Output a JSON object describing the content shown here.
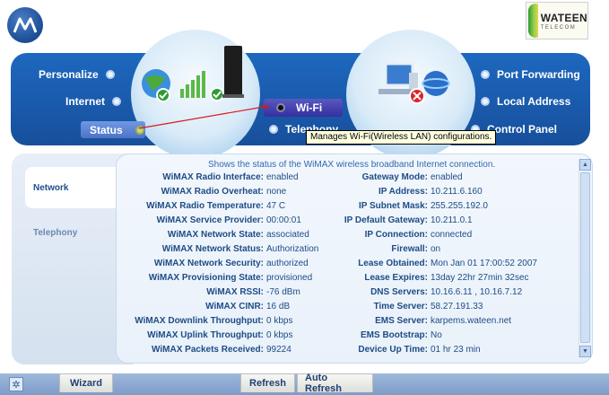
{
  "header": {
    "brand_logo": "motorola-logo",
    "partner_logo": {
      "name": "WATEEN",
      "tagline": "TELECOM"
    }
  },
  "nav": {
    "left_items": [
      {
        "label": "Personalize",
        "selected": false
      },
      {
        "label": "Internet",
        "selected": false
      },
      {
        "label": "Status",
        "selected": true
      }
    ],
    "center_items": [
      {
        "label": "Wi-Fi",
        "selected": true
      },
      {
        "label": "Telephony",
        "selected": false
      }
    ],
    "right_items": [
      {
        "label": "Port Forwarding",
        "selected": false
      },
      {
        "label": "Local Address",
        "selected": false
      },
      {
        "label": "Control Panel",
        "selected": false
      }
    ],
    "tooltip": "Manages Wi-Fi(Wireless LAN) configurations."
  },
  "side_tabs": {
    "network": "Network",
    "telephony": "Telephony"
  },
  "panel": {
    "title": "Shows the status of the WiMAX wireless broadband Internet connection.",
    "left_rows": [
      {
        "label": "WiMAX Radio Interface:",
        "value": "enabled"
      },
      {
        "label": "WiMAX Radio Overheat:",
        "value": "none"
      },
      {
        "label": "WiMAX Radio Temperature:",
        "value": "47 C"
      },
      {
        "label": "WiMAX Service Provider:",
        "value": "00:00:01"
      },
      {
        "label": "WiMAX Network State:",
        "value": "associated"
      },
      {
        "label": "WiMAX Network Status:",
        "value": "Authorization"
      },
      {
        "label": "WiMAX Network Security:",
        "value": "authorized"
      },
      {
        "label": "WiMAX Provisioning State:",
        "value": "provisioned"
      },
      {
        "label": "WiMAX RSSI:",
        "value": "-76 dBm"
      },
      {
        "label": "WiMAX CINR:",
        "value": "16 dB"
      },
      {
        "label": "WiMAX Downlink Throughput:",
        "value": "0 kbps"
      },
      {
        "label": "WiMAX Uplink Throughput:",
        "value": "0 kbps"
      },
      {
        "label": "WiMAX Packets Received:",
        "value": "99224"
      }
    ],
    "right_rows": [
      {
        "label": "Gateway Mode:",
        "value": "enabled"
      },
      {
        "label": "IP Address:",
        "value": "10.211.6.160"
      },
      {
        "label": "IP Subnet Mask:",
        "value": "255.255.192.0"
      },
      {
        "label": "IP Default Gateway:",
        "value": "10.211.0.1"
      },
      {
        "label": "IP Connection:",
        "value": "connected"
      },
      {
        "label": "Firewall:",
        "value": "on"
      },
      {
        "label": "Lease Obtained:",
        "value": "Mon Jan 01 17:00:52 2007"
      },
      {
        "label": "Lease Expires:",
        "value": "13day 22hr 27min 32sec"
      },
      {
        "label": "DNS Servers:",
        "value": "10.16.6.11 , 10.16.7.12"
      },
      {
        "label": "Time Server:",
        "value": "58.27.191.33"
      },
      {
        "label": "EMS Server:",
        "value": "karpems.wateen.net"
      },
      {
        "label": "EMS Bootstrap:",
        "value": "No"
      },
      {
        "label": "Device Up Time:",
        "value": "01 hr 23 min"
      }
    ]
  },
  "bottom": {
    "wizard": "Wizard",
    "refresh": "Refresh",
    "auto_refresh": "Auto Refresh"
  }
}
